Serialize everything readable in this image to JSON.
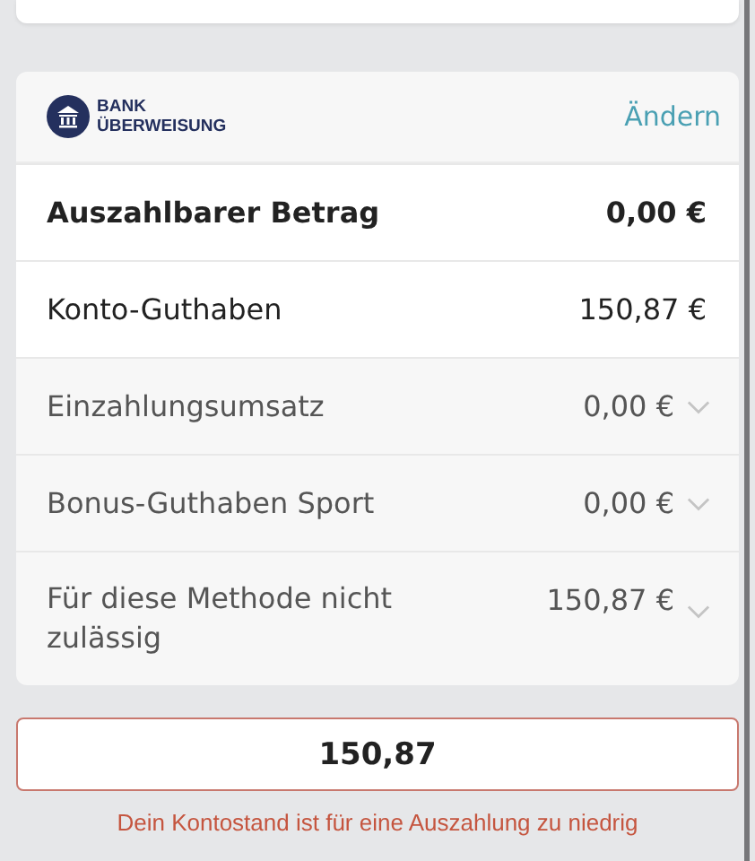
{
  "method": {
    "logo_line_1": "BANK",
    "logo_line_2": "ÜBERWEISUNG",
    "change_link": "Ändern"
  },
  "rows": [
    {
      "kind": "bold",
      "label": "Auszahlbarer Betrag",
      "value": "0,00 €"
    },
    {
      "kind": "plain",
      "label": "Konto-Guthaben",
      "value": "150,87 €"
    },
    {
      "kind": "expandable",
      "label": "Einzahlungsumsatz",
      "value": "0,00 €",
      "expanded": false
    },
    {
      "kind": "expandable",
      "label": "Bonus-Guthaben Sport",
      "value": "0,00 €",
      "expanded": false
    },
    {
      "kind": "expandable",
      "label": "Für diese Methode nicht zulässig",
      "value": "150,87 €",
      "expanded": false
    }
  ],
  "amount_field": {
    "value": "150,87",
    "error": "Dein Kontostand ist für eine Auszahlung zu niedrig"
  }
}
